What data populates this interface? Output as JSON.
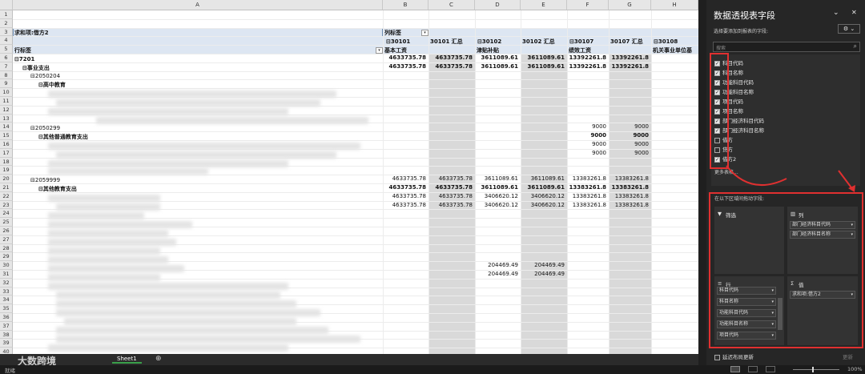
{
  "sheet": {
    "columns": [
      "A",
      "B",
      "C",
      "D",
      "E",
      "F",
      "G",
      "H"
    ],
    "rows": [
      "1",
      "2",
      "3",
      "4",
      "5",
      "6",
      "7",
      "8",
      "9",
      "10",
      "11",
      "12",
      "13",
      "14",
      "15",
      "16",
      "17",
      "18",
      "19",
      "20",
      "21",
      "22",
      "23",
      "24",
      "25",
      "26",
      "27",
      "28",
      "29",
      "30",
      "31",
      "32",
      "33",
      "34",
      "35",
      "36",
      "37",
      "38",
      "39",
      "40"
    ],
    "pivot_value_label": "求和项:借方2",
    "col_labels_label": "列标签",
    "row_labels_label": "行标签",
    "col_headers": [
      {
        "code": "⊟30101",
        "name": "基本工资"
      },
      {
        "code": "30101 汇总",
        "name": ""
      },
      {
        "code": "⊟30102",
        "name": "津贴补贴"
      },
      {
        "code": "30102 汇总",
        "name": ""
      },
      {
        "code": "⊟30107",
        "name": "绩效工资"
      },
      {
        "code": "30107 汇总",
        "name": ""
      },
      {
        "code": "⊟30108",
        "name": "机关事业单位基"
      }
    ],
    "tree": {
      "r6": "⊟7201",
      "r7": "⊟事业支出",
      "r8": "⊟2050204",
      "r9": "⊟高中教育",
      "r14": "⊟2050299",
      "r15": "⊟其他普通教育支出",
      "r20": "⊟2059999",
      "r21": "⊟其他教育支出"
    },
    "values": {
      "r6": [
        "4633735.78",
        "4633735.78",
        "3611089.61",
        "3611089.61",
        "13392261.8",
        "13392261.8"
      ],
      "r7": [
        "4633735.78",
        "4633735.78",
        "3611089.61",
        "3611089.61",
        "13392261.8",
        "13392261.8"
      ],
      "r14": [
        "",
        "",
        "",
        "",
        "9000",
        "9000"
      ],
      "r15": [
        "",
        "",
        "",
        "",
        "9000",
        "9000"
      ],
      "r16": [
        "",
        "",
        "",
        "",
        "9000",
        "9000"
      ],
      "r17": [
        "",
        "",
        "",
        "",
        "9000",
        "9000"
      ],
      "r20": [
        "4633735.78",
        "4633735.78",
        "3611089.61",
        "3611089.61",
        "13383261.8",
        "13383261.8"
      ],
      "r21": [
        "4633735.78",
        "4633735.78",
        "3611089.61",
        "3611089.61",
        "13383261.8",
        "13383261.8"
      ],
      "r22": [
        "4633735.78",
        "4633735.78",
        "3406620.12",
        "3406620.12",
        "13383261.8",
        "13383261.8"
      ],
      "r23": [
        "4633735.78",
        "4633735.78",
        "3406620.12",
        "3406620.12",
        "13383261.8",
        "13383261.8"
      ],
      "r30": [
        "",
        "",
        "204469.49",
        "204469.49",
        "",
        ""
      ],
      "r31": [
        "",
        "",
        "204469.49",
        "204469.49",
        "",
        ""
      ]
    }
  },
  "tabs": {
    "sheet_name": "Sheet1",
    "add_label": "⊕",
    "watermark": "大数跨境"
  },
  "status": {
    "left": "就绪",
    "zoom": "100%"
  },
  "pane": {
    "title": "数据透视表字段",
    "subtitle": "选择要添加到报表的字段:",
    "search_placeholder": "搜索",
    "close": "✕",
    "menu": "⌄",
    "gear": "⚙ ⌄",
    "fields": [
      {
        "label": "科目代码",
        "checked": true
      },
      {
        "label": "科目名称",
        "checked": true
      },
      {
        "label": "功能科目代码",
        "checked": true
      },
      {
        "label": "功能科目名称",
        "checked": true
      },
      {
        "label": "项目代码",
        "checked": true
      },
      {
        "label": "项目名称",
        "checked": true
      },
      {
        "label": "部门经济科目代码",
        "checked": true
      },
      {
        "label": "部门经济科目名称",
        "checked": true
      },
      {
        "label": "借方",
        "checked": false
      },
      {
        "label": "贷方",
        "checked": false
      },
      {
        "label": "借方2",
        "checked": true
      }
    ],
    "more_tables": "更多表格...",
    "drag_hint": "在以下区域间拖动字段:",
    "filter_title": "筛选",
    "columns_title": "列",
    "rows_title": "行",
    "values_title": "值",
    "column_chips": [
      "部门经济科目代码",
      "部门经济科目名称"
    ],
    "row_chips": [
      "科目代码",
      "科目名称",
      "功能科目代码",
      "功能科目名称",
      "项目代码"
    ],
    "value_chips": [
      "求和项:借方2"
    ],
    "defer_label": "延迟布局更新",
    "update_label": "更新"
  }
}
